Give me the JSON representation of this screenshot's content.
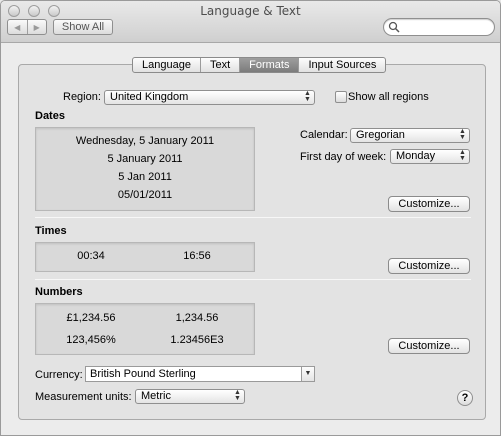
{
  "window": {
    "title": "Language & Text"
  },
  "toolbar": {
    "back": "◀",
    "forward": "▶",
    "show_all": "Show All",
    "search_placeholder": ""
  },
  "tabs": [
    {
      "label": "Language",
      "active": false
    },
    {
      "label": "Text",
      "active": false
    },
    {
      "label": "Formats",
      "active": true
    },
    {
      "label": "Input Sources",
      "active": false
    }
  ],
  "region": {
    "label": "Region:",
    "value": "United Kingdom",
    "show_all_label": "Show all regions",
    "show_all_checked": false
  },
  "dates": {
    "heading": "Dates",
    "samples": [
      "Wednesday, 5 January 2011",
      "5 January 2011",
      "5 Jan 2011",
      "05/01/2011"
    ],
    "calendar_label": "Calendar:",
    "calendar_value": "Gregorian",
    "first_day_label": "First day of week:",
    "first_day_value": "Monday",
    "customize": "Customize..."
  },
  "times": {
    "heading": "Times",
    "short": "00:34",
    "long": "16:56",
    "customize": "Customize..."
  },
  "numbers": {
    "heading": "Numbers",
    "currency_sample": "£1,234.56",
    "decimal_sample": "1,234.56",
    "percent_sample": "123,456%",
    "scientific_sample": "1.23456E3",
    "customize": "Customize..."
  },
  "currency": {
    "label": "Currency:",
    "value": "British Pound Sterling"
  },
  "measurement": {
    "label": "Measurement units:",
    "value": "Metric"
  },
  "help": "?"
}
